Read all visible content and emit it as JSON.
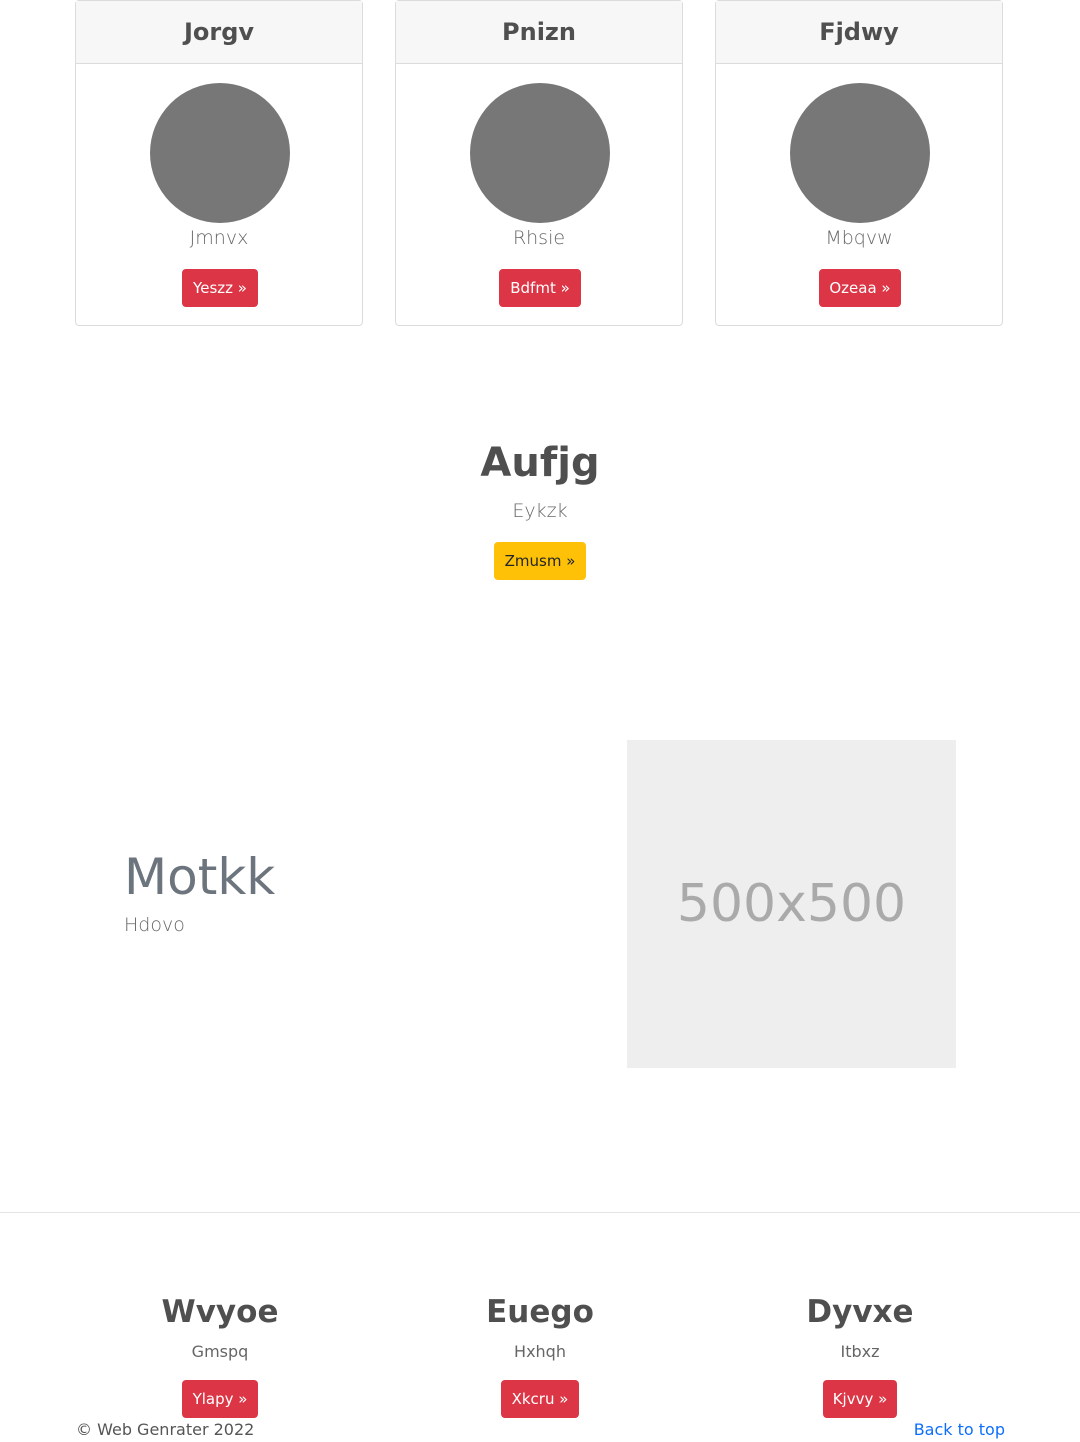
{
  "cards": [
    {
      "title": "Jorgv",
      "subtitle": "Jmnvx",
      "button": "Yeszz »"
    },
    {
      "title": "Pnizn",
      "subtitle": "Rhsie",
      "button": "Bdfmt »"
    },
    {
      "title": "Fjdwy",
      "subtitle": "Mbqvw",
      "button": "Ozeaa »"
    }
  ],
  "hero": {
    "title": "Aufjg",
    "subtitle": "Eykzk",
    "button": "Zmusm »"
  },
  "feature": {
    "title": "Motkk",
    "subtitle": "Hdovo",
    "image_text": "500x500"
  },
  "columns": [
    {
      "title": "Wvyoe",
      "subtitle": "Gmspq",
      "button": "Ylapy »"
    },
    {
      "title": "Euego",
      "subtitle": "Hxhqh",
      "button": "Xkcru »"
    },
    {
      "title": "Dyvxe",
      "subtitle": "Itbxz",
      "button": "Kjvvy »"
    }
  ],
  "footer": {
    "copyright": "© Web Genrater 2022",
    "back_to_top": "Back to top"
  },
  "colors": {
    "button_red": "#dc3545",
    "button_yellow": "#ffc107",
    "avatar": "#777777",
    "link": "#0d6efd"
  }
}
